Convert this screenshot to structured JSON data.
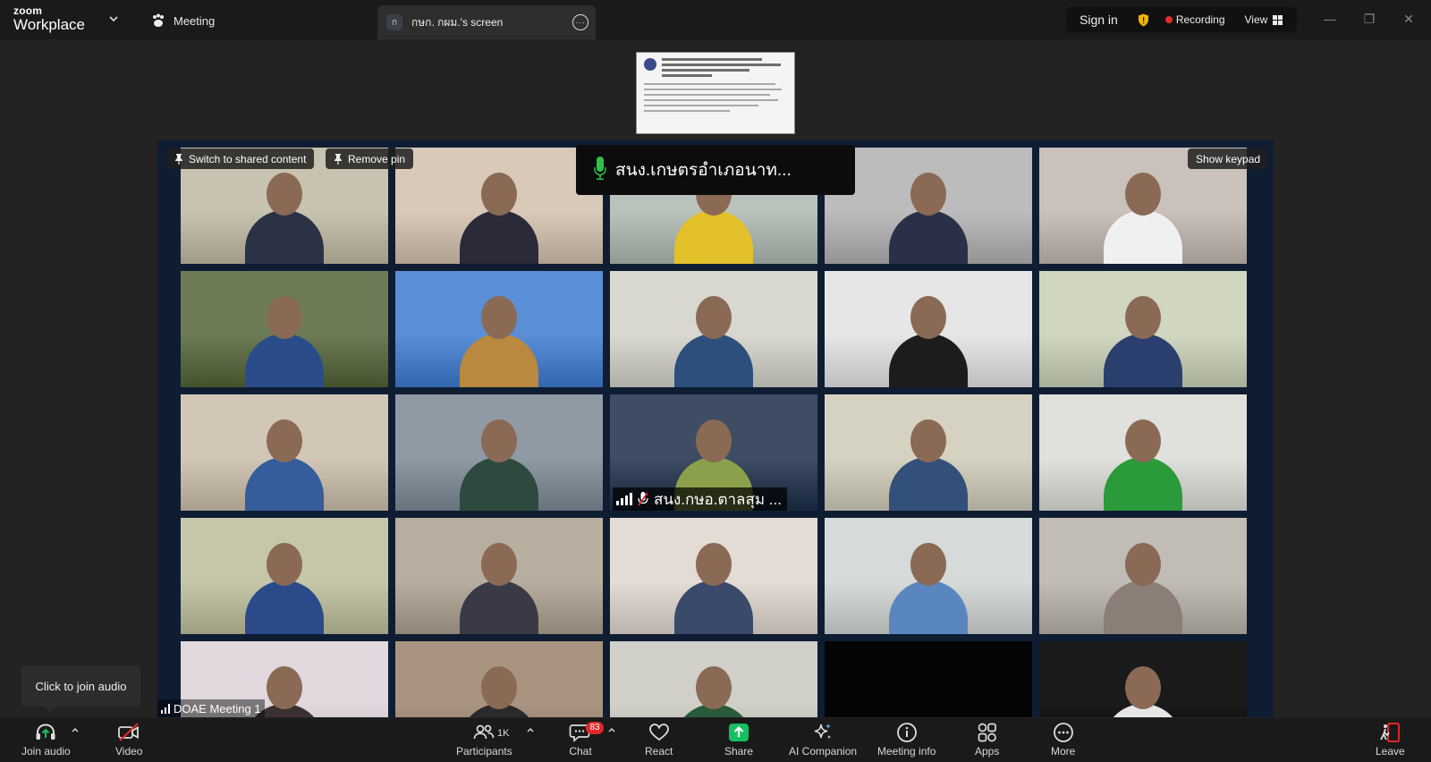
{
  "app": {
    "logo_line1": "zoom",
    "logo_line2": "Workplace"
  },
  "header": {
    "meeting_label": "Meeting",
    "screen_tab": {
      "avatar_letter": "ก",
      "title": "กษก. กผม.'s screen",
      "more": "···"
    },
    "signin": "Sign in",
    "recording": "Recording",
    "view": "View"
  },
  "gallery": {
    "switch_pill": "Switch to shared content",
    "remove_pin": "Remove pin",
    "show_keypad": "Show keypad",
    "active_speaker": "สนง.เกษตรอำเภอนาท...",
    "tile_label": "สนง.กษอ.ตาลสุม ...",
    "network_label": "DOAE Meeting 1"
  },
  "tooltip": {
    "text": "Click to join audio"
  },
  "toolbar": {
    "join_audio": "Join audio",
    "video": "Video",
    "participants": "Participants",
    "participant_count": "1K",
    "chat": "Chat",
    "chat_badge": "83",
    "react": "React",
    "share": "Share",
    "ai_companion": "AI Companion",
    "meeting_info": "Meeting info",
    "apps": "Apps",
    "more": "More",
    "leave": "Leave"
  },
  "colors": {
    "gallery_bg": "#0f1d33",
    "recording_dot": "#e52a2a",
    "share_green": "#16c060",
    "mic_green": "#2fc04a",
    "badge_red": "#e02828",
    "leave_red": "#e02828"
  },
  "tiles": [
    {
      "bg": "#c8c2b0",
      "fg": "#2b3245"
    },
    {
      "bg": "#d9c9b9",
      "fg": "#2a2a38"
    },
    {
      "bg": "#b9c2bb",
      "fg": "#e2c12b"
    },
    {
      "bg": "#bcbcbc",
      "fg": "#2a3048"
    },
    {
      "bg": "#c9c1ba",
      "fg": "#f0f0f0"
    },
    {
      "bg": "#6c7b55",
      "fg": "#2a4d8a"
    },
    {
      "bg": "#5a8ed6",
      "fg": "#b8893e"
    },
    {
      "bg": "#d8d8d0",
      "fg": "#2c4f7c"
    },
    {
      "bg": "#e6e6e6",
      "fg": "#1c1c1c"
    },
    {
      "bg": "#d0d6c0",
      "fg": "#2a3f6e"
    },
    {
      "bg": "#d2c6b6",
      "fg": "#355c9b"
    },
    {
      "bg": "#8f9aa4",
      "fg": "#2e4a3e"
    },
    {
      "bg": "#3e4d63",
      "fg": "#8aa04a"
    },
    {
      "bg": "#d6d2c2",
      "fg": "#33507a"
    },
    {
      "bg": "#e0e0dc",
      "fg": "#2a9a3a"
    },
    {
      "bg": "#c6c7aa",
      "fg": "#2a4a8a"
    },
    {
      "bg": "#b8aea0",
      "fg": "#3a3a46"
    },
    {
      "bg": "#e2dcd4",
      "fg": "#3a4a6a"
    },
    {
      "bg": "#d6dad8",
      "fg": "#5a86c0"
    },
    {
      "bg": "#c2bcb6",
      "fg": "#8a7e76"
    },
    {
      "bg": "#e0d8dc",
      "fg": "#3a3030"
    },
    {
      "bg": "#a89480",
      "fg": "#2a2a2a"
    },
    {
      "bg": "#d0cfc8",
      "fg": "#2a5a3a"
    },
    {
      "bg": "#050505",
      "fg": "#050505"
    },
    {
      "bg": "#1a1a1a",
      "fg": "#e6e6e6"
    }
  ]
}
